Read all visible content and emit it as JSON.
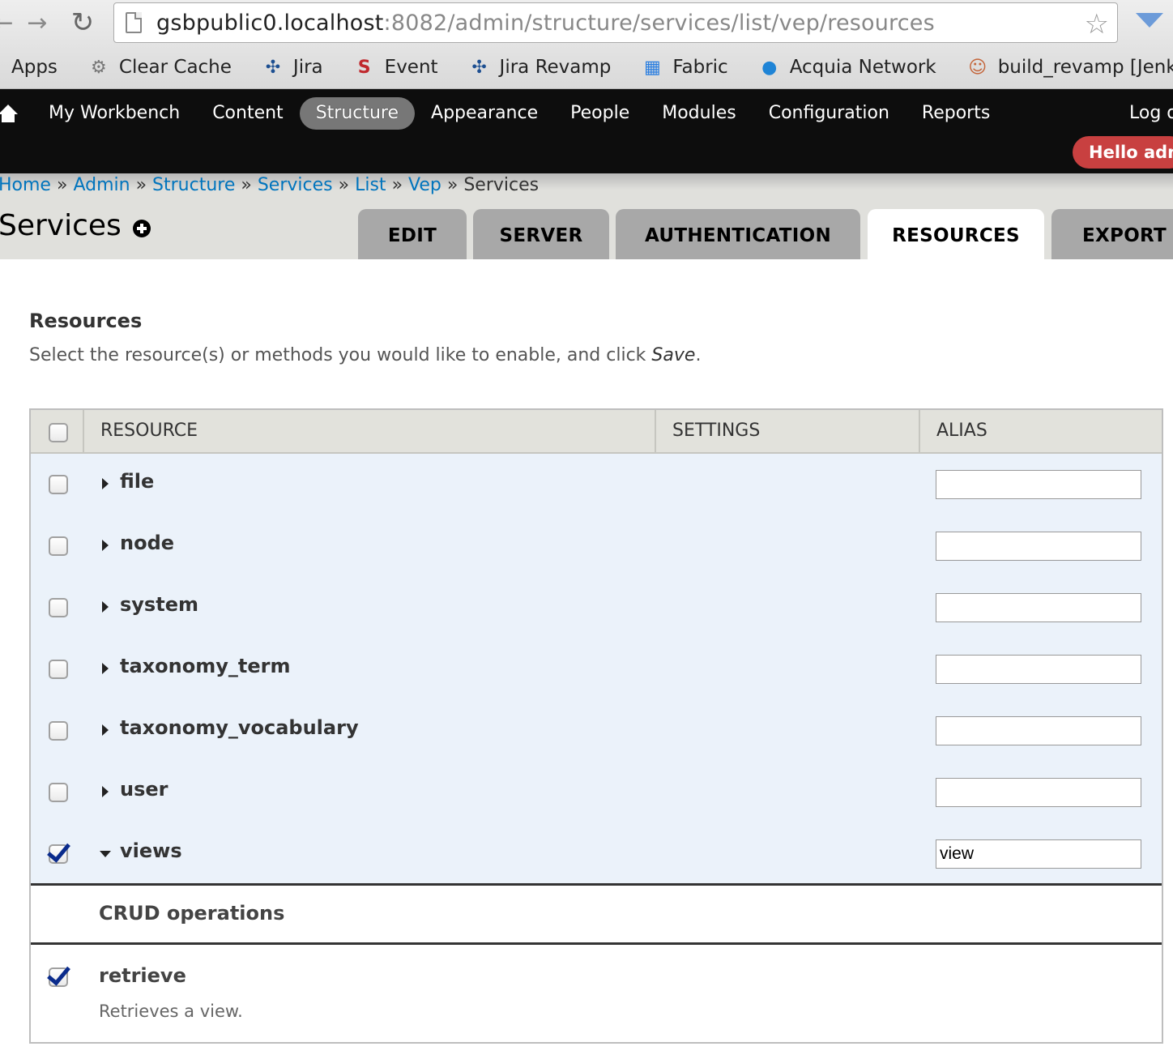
{
  "browser": {
    "url_host": "gsbpublic0.localhost",
    "url_rest": ":8082/admin/structure/services/list/vep/resources",
    "bookmarks": [
      {
        "label": "Apps",
        "icon": "apps-icon"
      },
      {
        "label": "Clear Cache",
        "icon": "gear-icon"
      },
      {
        "label": "Jira",
        "icon": "jira-icon"
      },
      {
        "label": "Event",
        "icon": "stanford-s-icon"
      },
      {
        "label": "Jira Revamp",
        "icon": "jira-icon"
      },
      {
        "label": "Fabric",
        "icon": "fabric-icon"
      },
      {
        "label": "Acquia Network",
        "icon": "acquia-drop-icon"
      },
      {
        "label": "build_revamp [Jenkin",
        "icon": "jenkins-icon"
      }
    ]
  },
  "toolbar": {
    "items": [
      "My Workbench",
      "Content",
      "Structure",
      "Appearance",
      "People",
      "Modules",
      "Configuration",
      "Reports"
    ],
    "active": "Structure",
    "logout": "Log o",
    "hello": "Hello adm"
  },
  "breadcrumb": {
    "links": [
      "Home",
      "Admin",
      "Structure",
      "Services",
      "List",
      "Vep"
    ],
    "separator": "»",
    "current": "Services"
  },
  "page_title": "Services",
  "tabs": [
    {
      "label": "EDIT",
      "active": false
    },
    {
      "label": "SERVER",
      "active": false
    },
    {
      "label": "AUTHENTICATION",
      "active": false
    },
    {
      "label": "RESOURCES",
      "active": true
    },
    {
      "label": "EXPORT",
      "active": false
    }
  ],
  "section": {
    "title": "Resources",
    "description_before": "Select the resource(s) or methods you would like to enable, and click ",
    "description_emphasis": "Save",
    "description_after": "."
  },
  "table": {
    "headers": {
      "resource": "RESOURCE",
      "settings": "SETTINGS",
      "alias": "ALIAS"
    },
    "rows": [
      {
        "name": "file",
        "checked": false,
        "expanded": false,
        "alias": ""
      },
      {
        "name": "node",
        "checked": false,
        "expanded": false,
        "alias": ""
      },
      {
        "name": "system",
        "checked": false,
        "expanded": false,
        "alias": ""
      },
      {
        "name": "taxonomy_term",
        "checked": false,
        "expanded": false,
        "alias": ""
      },
      {
        "name": "taxonomy_vocabulary",
        "checked": false,
        "expanded": false,
        "alias": ""
      },
      {
        "name": "user",
        "checked": false,
        "expanded": false,
        "alias": ""
      },
      {
        "name": "views",
        "checked": true,
        "expanded": true,
        "alias": "view"
      }
    ]
  },
  "crud": {
    "title": "CRUD operations",
    "operation": {
      "name": "retrieve",
      "checked": true,
      "description": "Retrieves a view."
    }
  },
  "colors": {
    "toolbar_bg": "#0d0d0d",
    "link": "#0074bd",
    "hello_badge": "#c84040",
    "row_bg": "#ebf2fa"
  }
}
